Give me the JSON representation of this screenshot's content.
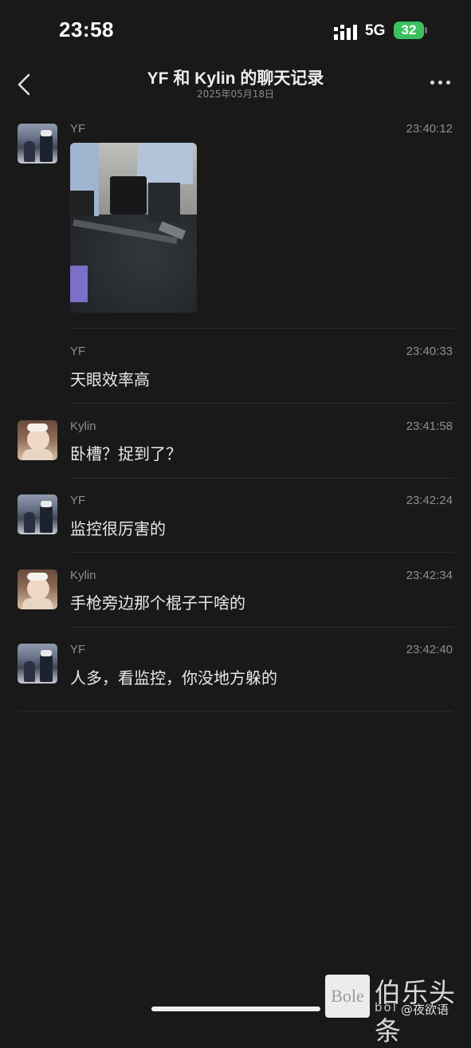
{
  "status_bar": {
    "time": "23:58",
    "network": "5G",
    "battery": "32"
  },
  "header": {
    "back_icon": "chevron-left-icon",
    "title": "YF 和 Kylin 的聊天记录",
    "subtitle": "2025年05月18日",
    "more_icon": "more-dots-icon"
  },
  "messages": [
    {
      "sender": "YF",
      "time": "23:40:12",
      "type": "image"
    },
    {
      "sender": "YF",
      "time": "23:40:33",
      "text": "天眼效率高"
    },
    {
      "sender": "Kylin",
      "time": "23:41:58",
      "text": "卧槽？捉到了？"
    },
    {
      "sender": "YF",
      "time": "23:42:24",
      "text": "监控很厉害的"
    },
    {
      "sender": "Kylin",
      "time": "23:42:34",
      "text": "手枪旁边那个棍子干啥的"
    },
    {
      "sender": "YF",
      "time": "23:42:40",
      "text": "人多，看监控，你没地方躲的"
    }
  ],
  "watermark": {
    "logo": "Bole",
    "brand": "伯乐头条",
    "site": "bol",
    "user": "@夜欲语"
  },
  "colors": {
    "background": "#191919",
    "battery_green": "#3cc15f",
    "secondary_text": "#8e8e8e"
  }
}
